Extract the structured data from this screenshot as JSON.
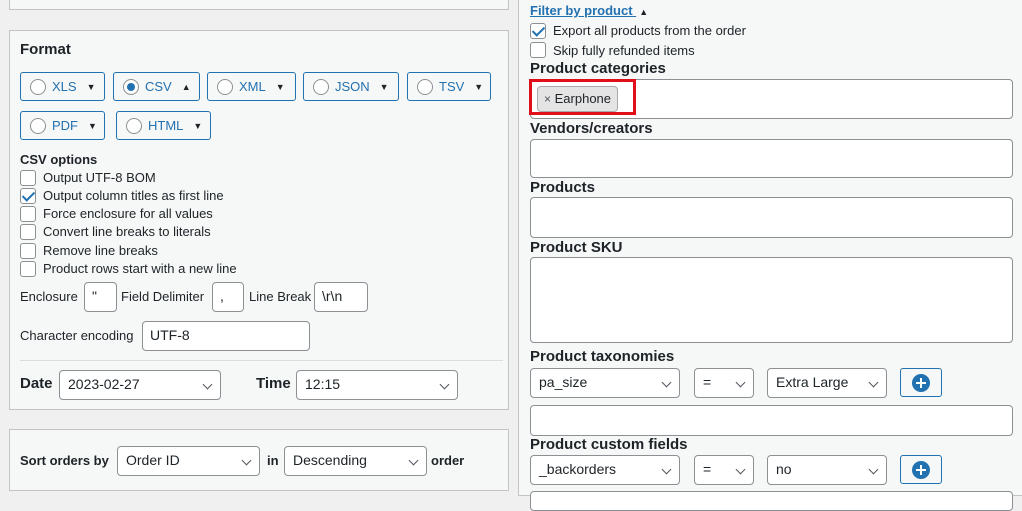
{
  "format": {
    "title": "Format",
    "buttons": [
      {
        "label": "XLS",
        "selected": false,
        "caret": "▼"
      },
      {
        "label": "CSV",
        "selected": true,
        "caret": "▲"
      },
      {
        "label": "XML",
        "selected": false,
        "caret": "▼"
      },
      {
        "label": "JSON",
        "selected": false,
        "caret": "▼"
      },
      {
        "label": "TSV",
        "selected": false,
        "caret": "▼"
      },
      {
        "label": "PDF",
        "selected": false,
        "caret": "▼"
      },
      {
        "label": "HTML",
        "selected": false,
        "caret": "▼"
      }
    ]
  },
  "csv_options": {
    "title": "CSV options",
    "checkboxes": [
      {
        "label": "Output UTF-8 BOM",
        "checked": false
      },
      {
        "label": "Output column titles as first line",
        "checked": true
      },
      {
        "label": "Force enclosure for all values",
        "checked": false
      },
      {
        "label": "Convert line breaks to literals",
        "checked": false
      },
      {
        "label": "Remove line breaks",
        "checked": false
      },
      {
        "label": "Product rows start with a new line",
        "checked": false
      }
    ],
    "enclosure_label": "Enclosure",
    "enclosure_value": "\"",
    "delimiter_label": "Field Delimiter",
    "delimiter_value": ",",
    "linebreak_label": "Line Break",
    "linebreak_value": "\\r\\n",
    "encoding_label": "Character encoding",
    "encoding_value": "UTF-8"
  },
  "datetime": {
    "date_label": "Date",
    "date_value": "2023-02-27",
    "time_label": "Time",
    "time_value": "12:15"
  },
  "sort": {
    "prefix": "Sort orders by",
    "field_value": "Order ID",
    "in_label": "in",
    "direction_value": "Descending",
    "suffix": "order"
  },
  "filter": {
    "title": "Filter by product",
    "title_caret": "▲",
    "export_all_label": "Export all products from the order",
    "export_all_checked": true,
    "skip_refunded_label": "Skip fully refunded items",
    "skip_refunded_checked": false,
    "categories_label": "Product categories",
    "category_tag": "Earphone",
    "tag_remove": "×",
    "vendors_label": "Vendors/creators",
    "products_label": "Products",
    "sku_label": "Product SKU",
    "taxonomies_label": "Product taxonomies",
    "taxonomy_field": "pa_size",
    "taxonomy_op": "=",
    "taxonomy_value": "Extra Large",
    "custom_fields_label": "Product custom fields",
    "custom_field": "_backorders",
    "custom_op": "=",
    "custom_value": "no"
  },
  "colors": {
    "accent": "#2271b1",
    "highlight": "#e0101a"
  }
}
